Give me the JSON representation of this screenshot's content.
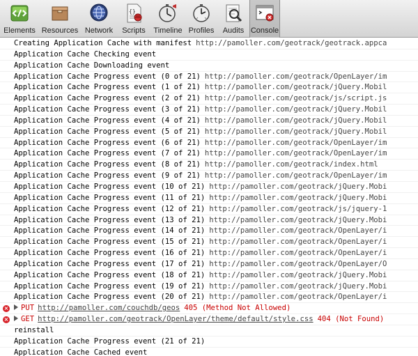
{
  "toolbar": {
    "tabs": [
      {
        "label": "Elements",
        "icon": "elements-icon"
      },
      {
        "label": "Resources",
        "icon": "resources-icon"
      },
      {
        "label": "Network",
        "icon": "network-icon"
      },
      {
        "label": "Scripts",
        "icon": "scripts-icon"
      },
      {
        "label": "Timeline",
        "icon": "timeline-icon"
      },
      {
        "label": "Profiles",
        "icon": "profiles-icon"
      },
      {
        "label": "Audits",
        "icon": "audits-icon"
      },
      {
        "label": "Console",
        "icon": "console-icon"
      }
    ],
    "active": "Console"
  },
  "console": {
    "lines": [
      {
        "text": "Creating Application Cache with manifest",
        "url": "http://pamoller.com/geotrack/geotrack.appca"
      },
      {
        "text": "Application Cache Checking event"
      },
      {
        "text": "Application Cache Downloading event"
      },
      {
        "text": "Application Cache Progress event (0 of 21)",
        "url": "http://pamoller.com/geotrack/OpenLayer/im"
      },
      {
        "text": "Application Cache Progress event (1 of 21)",
        "url": "http://pamoller.com/geotrack/jQuery.Mobil"
      },
      {
        "text": "Application Cache Progress event (2 of 21)",
        "url": "http://pamoller.com/geotrack/js/script.js"
      },
      {
        "text": "Application Cache Progress event (3 of 21)",
        "url": "http://pamoller.com/geotrack/jQuery.Mobil"
      },
      {
        "text": "Application Cache Progress event (4 of 21)",
        "url": "http://pamoller.com/geotrack/jQuery.Mobil"
      },
      {
        "text": "Application Cache Progress event (5 of 21)",
        "url": "http://pamoller.com/geotrack/jQuery.Mobil"
      },
      {
        "text": "Application Cache Progress event (6 of 21)",
        "url": "http://pamoller.com/geotrack/OpenLayer/im"
      },
      {
        "text": "Application Cache Progress event (7 of 21)",
        "url": "http://pamoller.com/geotrack/OpenLayer/im"
      },
      {
        "text": "Application Cache Progress event (8 of 21)",
        "url": "http://pamoller.com/geotrack/index.html"
      },
      {
        "text": "Application Cache Progress event (9 of 21)",
        "url": "http://pamoller.com/geotrack/OpenLayer/im"
      },
      {
        "text": "Application Cache Progress event (10 of 21)",
        "url": "http://pamoller.com/geotrack/jQuery.Mobi"
      },
      {
        "text": "Application Cache Progress event (11 of 21)",
        "url": "http://pamoller.com/geotrack/jQuery.Mobi"
      },
      {
        "text": "Application Cache Progress event (12 of 21)",
        "url": "http://pamoller.com/geotrack/js/jquery-1"
      },
      {
        "text": "Application Cache Progress event (13 of 21)",
        "url": "http://pamoller.com/geotrack/jQuery.Mobi"
      },
      {
        "text": "Application Cache Progress event (14 of 21)",
        "url": "http://pamoller.com/geotrack/OpenLayer/i"
      },
      {
        "text": "Application Cache Progress event (15 of 21)",
        "url": "http://pamoller.com/geotrack/OpenLayer/i"
      },
      {
        "text": "Application Cache Progress event (16 of 21)",
        "url": "http://pamoller.com/geotrack/OpenLayer/i"
      },
      {
        "text": "Application Cache Progress event (17 of 21)",
        "url": "http://pamoller.com/geotrack/OpenLayer/O"
      },
      {
        "text": "Application Cache Progress event (18 of 21)",
        "url": "http://pamoller.com/geotrack/jQuery.Mobi"
      },
      {
        "text": "Application Cache Progress event (19 of 21)",
        "url": "http://pamoller.com/geotrack/jQuery.Mobi"
      },
      {
        "text": "Application Cache Progress event (20 of 21)",
        "url": "http://pamoller.com/geotrack/OpenLayer/i"
      }
    ],
    "errors": [
      {
        "method": "PUT",
        "url": "http://pamoller.com/couchdb/geos",
        "status": "405 (Method Not Allowed)"
      },
      {
        "method": "GET",
        "url": "http://pamoller.com/geotrack/OpenLayer/theme/default/style.css",
        "status": "404 (Not Found)"
      }
    ],
    "after": [
      {
        "text": "reinstall"
      },
      {
        "text": "Application Cache Progress event (21 of 21)"
      },
      {
        "text": "Application Cache Cached event"
      }
    ]
  },
  "colors": {
    "error_red": "#c80000",
    "toolbar_top": "#f1f1f1",
    "toolbar_bottom": "#d4d4d4"
  }
}
